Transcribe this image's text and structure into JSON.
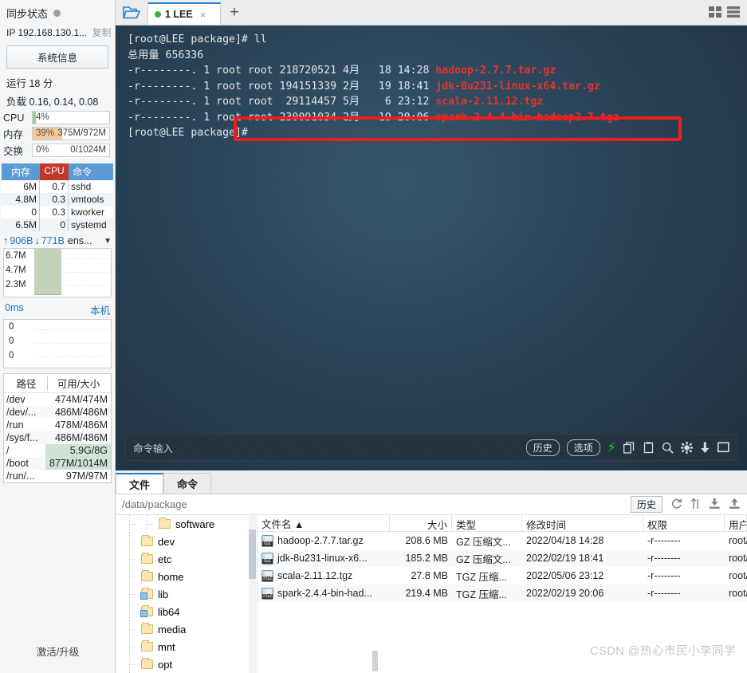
{
  "sidebar": {
    "sync_status": "同步状态",
    "ip_line": "IP 192.168.130.1...",
    "copy_label": "复制",
    "sysinfo_button": "系统信息",
    "uptime": "运行 18 分",
    "load": "负载 0.16, 0.14, 0.08",
    "meters": [
      {
        "label": "CPU",
        "pct": "4%",
        "value": "",
        "fill_pct": 4,
        "color": "#8fd18f"
      },
      {
        "label": "内存",
        "pct": "39%",
        "value": "375M/972M",
        "fill_pct": 39,
        "color": "#f6c89a"
      },
      {
        "label": "交换",
        "pct": "0%",
        "value": "0/1024M",
        "fill_pct": 0,
        "color": "#f6c89a"
      }
    ],
    "proc_headers": {
      "mem": "内存",
      "cpu": "CPU",
      "cmd": "命令"
    },
    "processes": [
      {
        "mem": "6M",
        "cpu": "0.7",
        "cmd": "sshd"
      },
      {
        "mem": "4.8M",
        "cpu": "0.3",
        "cmd": "vmtools"
      },
      {
        "mem": "0",
        "cpu": "0.3",
        "cmd": "kworker"
      },
      {
        "mem": "6.5M",
        "cpu": "0",
        "cmd": "systemd"
      }
    ],
    "net": {
      "up_value": "906B",
      "down_value": "771B",
      "interface": "ens...",
      "y_labels": [
        "6.7M",
        "4.7M",
        "2.3M"
      ]
    },
    "latency": {
      "value": "0ms",
      "target": "本机",
      "y_labels": [
        "0",
        "0",
        "0"
      ]
    },
    "disk_headers": {
      "path": "路径",
      "size": "可用/大小"
    },
    "disks": [
      {
        "path": "/dev",
        "size": "474M/474M",
        "highlight": false
      },
      {
        "path": "/dev/...",
        "size": "486M/486M",
        "highlight": false
      },
      {
        "path": "/run",
        "size": "478M/486M",
        "highlight": false
      },
      {
        "path": "/sys/f...",
        "size": "486M/486M",
        "highlight": false
      },
      {
        "path": "/",
        "size": "5.9G/8G",
        "highlight": true
      },
      {
        "path": "/boot",
        "size": "877M/1014M",
        "highlight": true
      },
      {
        "path": "/run/...",
        "size": "97M/97M",
        "highlight": false
      }
    ],
    "bottom_label": "激活/升级"
  },
  "tabbar": {
    "folder_icon": "open-folder-icon",
    "tab_label": "1 LEE",
    "tab_close": "×",
    "new_tab": "+",
    "grid_icon": "grid-view-icon",
    "list_icon": "list-view-icon"
  },
  "terminal": {
    "lines": [
      {
        "text": "[root@LEE package]# ll",
        "file": ""
      },
      {
        "text": "总用量 656336",
        "file": ""
      },
      {
        "text": "-r--------. 1 root root 218720521 4月   18 14:28 ",
        "file": "hadoop-2.7.7.tar.gz"
      },
      {
        "text": "-r--------. 1 root root 194151339 2月   19 18:41 ",
        "file": "jdk-8u231-linux-x64.tar.gz"
      },
      {
        "text": "-r--------. 1 root root  29114457 5月    6 23:12 ",
        "file": "scala-2.11.12.tgz"
      },
      {
        "text": "-r--------. 1 root root 230091034 2月   19 20:06 ",
        "file": "spark-2.4.4-bin-hadoop2.7.tgz"
      },
      {
        "text": "[root@LEE package]#",
        "file": ""
      }
    ],
    "highlight_color": "#ee1c1c",
    "cmd_placeholder": "命令输入",
    "history_button": "历史",
    "options_button": "选项",
    "icons": [
      "bolt-icon",
      "copy-icon",
      "paste-icon",
      "search-icon",
      "gear-icon",
      "download-icon",
      "window-icon"
    ]
  },
  "filepanel": {
    "tabs": [
      {
        "label": "文件",
        "active": true
      },
      {
        "label": "命令",
        "active": false
      }
    ],
    "path": "/data/package",
    "history_button": "历史",
    "toolbar_icons": [
      "refresh-icon",
      "sort-icon",
      "download-icon",
      "upload-icon"
    ],
    "tree": [
      {
        "label": "software",
        "indent": 2,
        "link": false
      },
      {
        "label": "dev",
        "indent": 1,
        "link": false
      },
      {
        "label": "etc",
        "indent": 1,
        "link": false
      },
      {
        "label": "home",
        "indent": 1,
        "link": false
      },
      {
        "label": "lib",
        "indent": 1,
        "link": true
      },
      {
        "label": "lib64",
        "indent": 1,
        "link": true
      },
      {
        "label": "media",
        "indent": 1,
        "link": false
      },
      {
        "label": "mnt",
        "indent": 1,
        "link": false
      },
      {
        "label": "opt",
        "indent": 1,
        "link": false
      }
    ],
    "columns": [
      "文件名",
      "大小",
      "类型",
      "修改时间",
      "权限",
      "用户/用户组"
    ],
    "sort_arrow": "▲",
    "rows": [
      {
        "name": "hadoop-2.7.7.tar.gz",
        "tag": "GZ",
        "size": "208.6 MB",
        "type": "GZ 压缩文...",
        "time": "2022/04/18 14:28",
        "perm": "-r--------",
        "user": "root/root"
      },
      {
        "name": "jdk-8u231-linux-x6...",
        "tag": "GZ",
        "size": "185.2 MB",
        "type": "GZ 压缩文...",
        "time": "2022/02/19 18:41",
        "perm": "-r--------",
        "user": "root/root"
      },
      {
        "name": "scala-2.11.12.tgz",
        "tag": "TGZ",
        "size": "27.8 MB",
        "type": "TGZ 压缩...",
        "time": "2022/05/06 23:12",
        "perm": "-r--------",
        "user": "root/root"
      },
      {
        "name": "spark-2.4.4-bin-had...",
        "tag": "TGZ",
        "size": "219.4 MB",
        "type": "TGZ 压缩...",
        "time": "2022/02/19 20:06",
        "perm": "-r--------",
        "user": "root/root"
      }
    ]
  },
  "watermark": "CSDN @热心市民小李同学"
}
